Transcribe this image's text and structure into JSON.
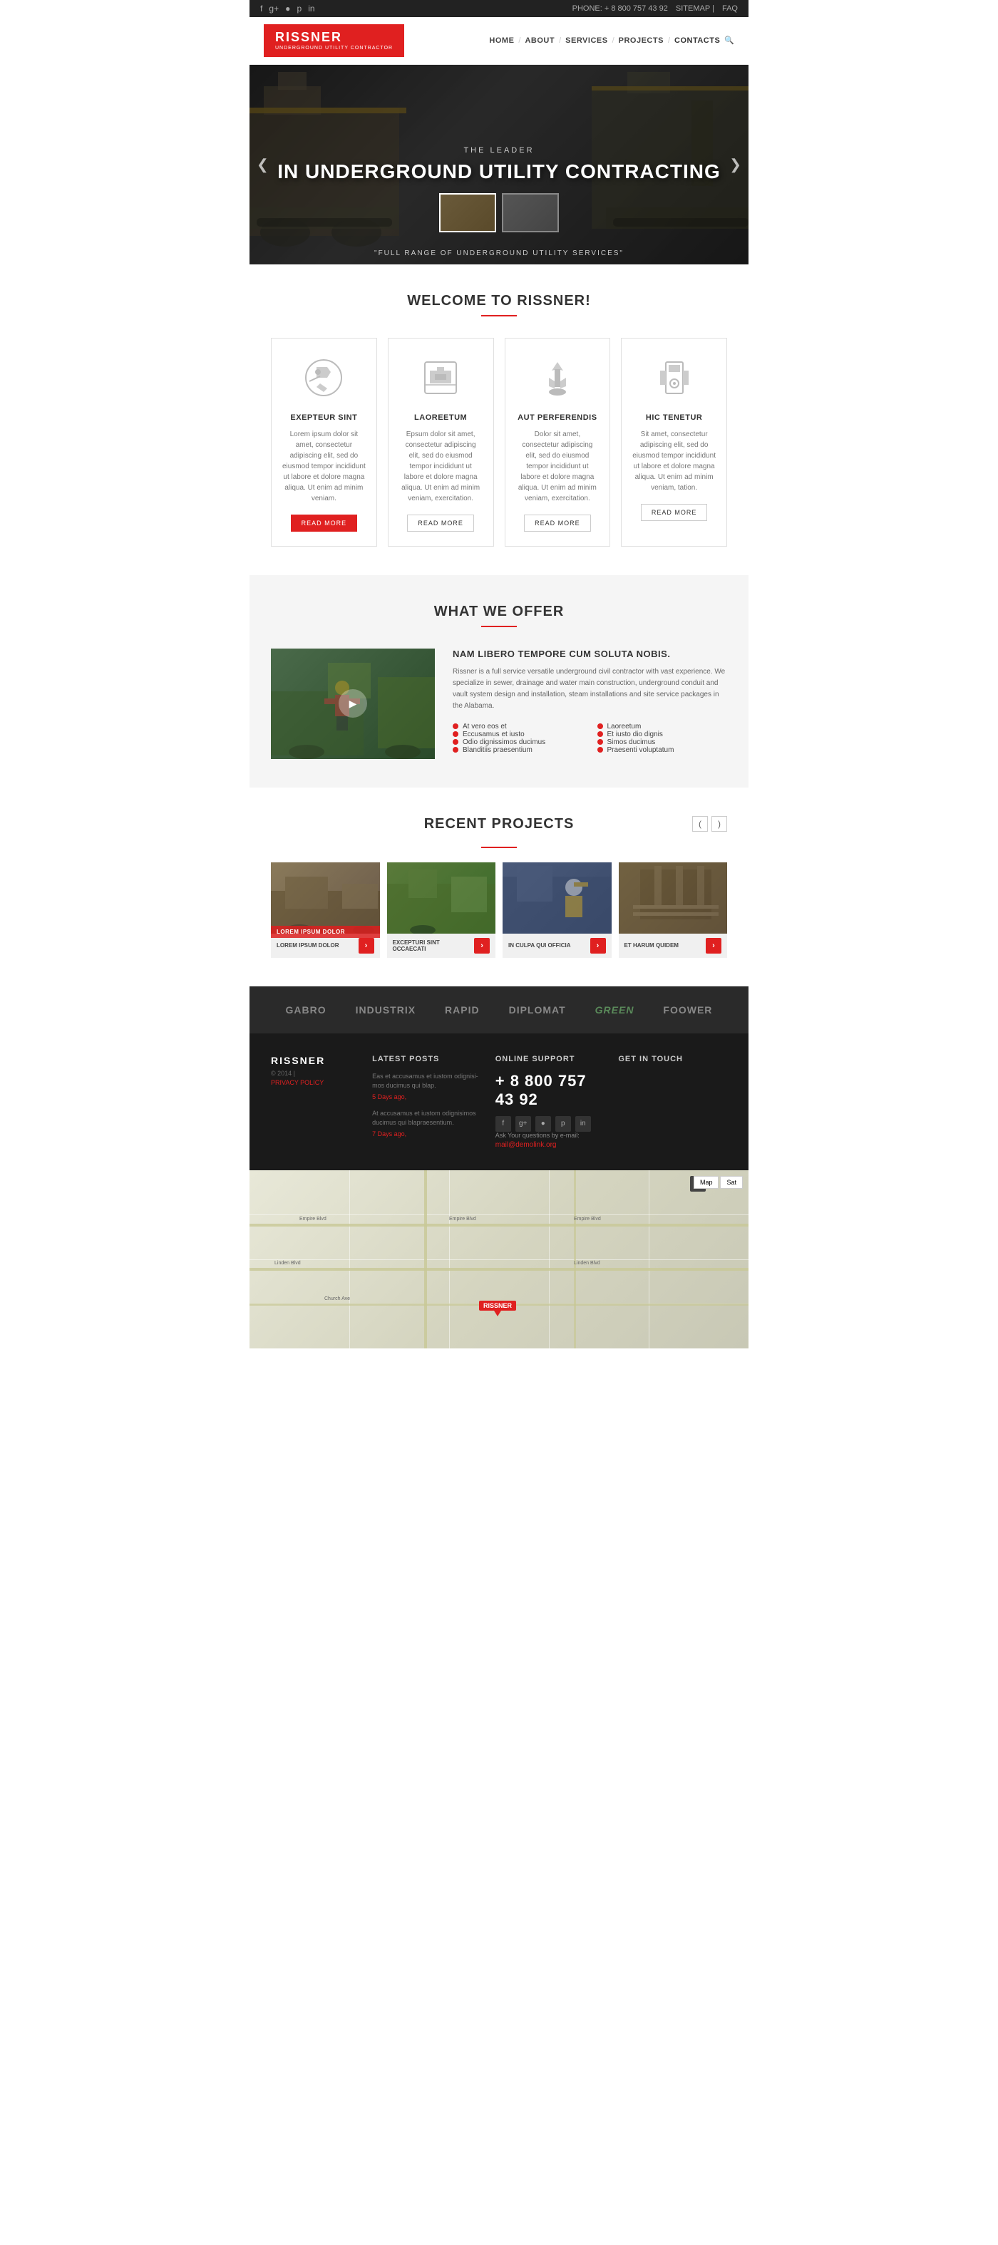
{
  "topbar": {
    "phone": "PHONE: + 8 800 757 43 92",
    "sitemap": "SITEMAP",
    "faq": "FAQ",
    "social_icons": [
      "f",
      "g+",
      "rss",
      "p",
      "in"
    ]
  },
  "nav": {
    "logo_name": "RISSNER",
    "logo_sub": "UNDERGROUND UTILITY CONTRACTOR",
    "links": [
      "HOME",
      "ABOUT",
      "SERVICES",
      "PROJECTS",
      "CONTACTS"
    ],
    "contacts_label": "CONTACTS"
  },
  "hero": {
    "subtitle": "THE LEADER",
    "title": "IN UNDERGROUND UTILITY CONTRACTING",
    "caption": "\"FULL RANGE OF UNDERGROUND UTILITY SERVICES\""
  },
  "welcome": {
    "title": "WELCOME TO RISSNER!",
    "features": [
      {
        "id": "f1",
        "title": "EXEPTEUR SINT",
        "text": "Lorem ipsum dolor sit amet, consectetur adipiscing elit, sed do eiusmod tempor incididunt ut labore et dolore magna aliqua. Ut enim ad minim veniam.",
        "btn": "READ MORE",
        "btn_red": true
      },
      {
        "id": "f2",
        "title": "LAOREETUM",
        "text": "Epsum dolor sit amet, consectetur adipiscing elit, sed do eiusmod tempor incididunt ut labore et dolore magna aliqua. Ut enim ad minim veniam, exercitation.",
        "btn": "READ MORE",
        "btn_red": false
      },
      {
        "id": "f3",
        "title": "AUT PERFERENDIS",
        "text": "Dolor sit amet, consectetur adipiscing elit, sed do eiusmod tempor incididunt ut labore et dolore magna aliqua. Ut enim ad minim veniam, exercitation.",
        "btn": "READ MORE",
        "btn_red": false
      },
      {
        "id": "f4",
        "title": "HIC TENETUR",
        "text": "Sit amet, consectetur adipiscing elit, sed do eiusmod tempor incididunt ut labore et dolore magna aliqua. Ut enim ad minim veniam, tation.",
        "btn": "READ MORE",
        "btn_red": false
      }
    ]
  },
  "offer": {
    "section_title": "WHAT WE OFFER",
    "headline": "NAM LIBERO TEMPORE CUM SOLUTA NOBIS.",
    "description": "Rissner is a full service versatile underground civil contractor with vast experience. We specialize in sewer, drainage and water main construction, underground conduit and vault system design and installation, steam installations and site service packages in the Alabama.",
    "list_left": [
      "At vero eos et",
      "Eccusamus et iusto",
      "Odio dignissimos ducimus",
      "Blanditiis praesentium"
    ],
    "list_right": [
      "Laoreetum",
      "Et iusto dio dignis",
      "Simos ducimus",
      "Praesenti voluptatum"
    ]
  },
  "projects": {
    "section_title": "RECENT PROJECTS",
    "items": [
      {
        "label": "LOREM IPSUM DOLOR",
        "title": "LOREM IPSUM DOLOR",
        "featured": true
      },
      {
        "label": "",
        "title": "EXCEPTURI SINT OCCAECATI",
        "featured": false
      },
      {
        "label": "",
        "title": "IN CULPA QUI OFFICIA",
        "featured": false
      },
      {
        "label": "",
        "title": "ET HARUM QUIDEM",
        "featured": false
      }
    ]
  },
  "partners": {
    "logos": [
      "GABRO",
      "INDUSTRIX",
      "RAPID",
      "DIPLOMAT",
      "green",
      "FOOWER"
    ]
  },
  "footer": {
    "logo": "RISSNER",
    "copyright": "© 2014 |",
    "privacy": "PRIVACY POLICY",
    "sections": {
      "latest_posts": {
        "title": "LATEST POSTS",
        "posts": [
          {
            "text": "Eas et accusamus et iustom odignisi-mos ducimus qui blap.",
            "date": "5 Days ago,"
          },
          {
            "text": "At accusamus et iustom odignisimos ducimus qui blapraesentium.",
            "date": "7 Days ago,"
          }
        ]
      },
      "online_support": {
        "title": "ONLINE SUPPORT",
        "phone": "+ 8 800 757 43 92",
        "ask_label": "Ask Your questions by e-mail:",
        "email": "mail@demolink.org",
        "social_icons": [
          "f",
          "g+",
          "rss",
          "p",
          "in"
        ]
      },
      "get_in_touch": {
        "title": "GET IN TOUCH"
      }
    }
  },
  "map": {
    "controls": [
      "Map",
      "Sat"
    ],
    "roads": [
      "Empire Blvd",
      "Linden Blvd",
      "Church Ave"
    ]
  }
}
